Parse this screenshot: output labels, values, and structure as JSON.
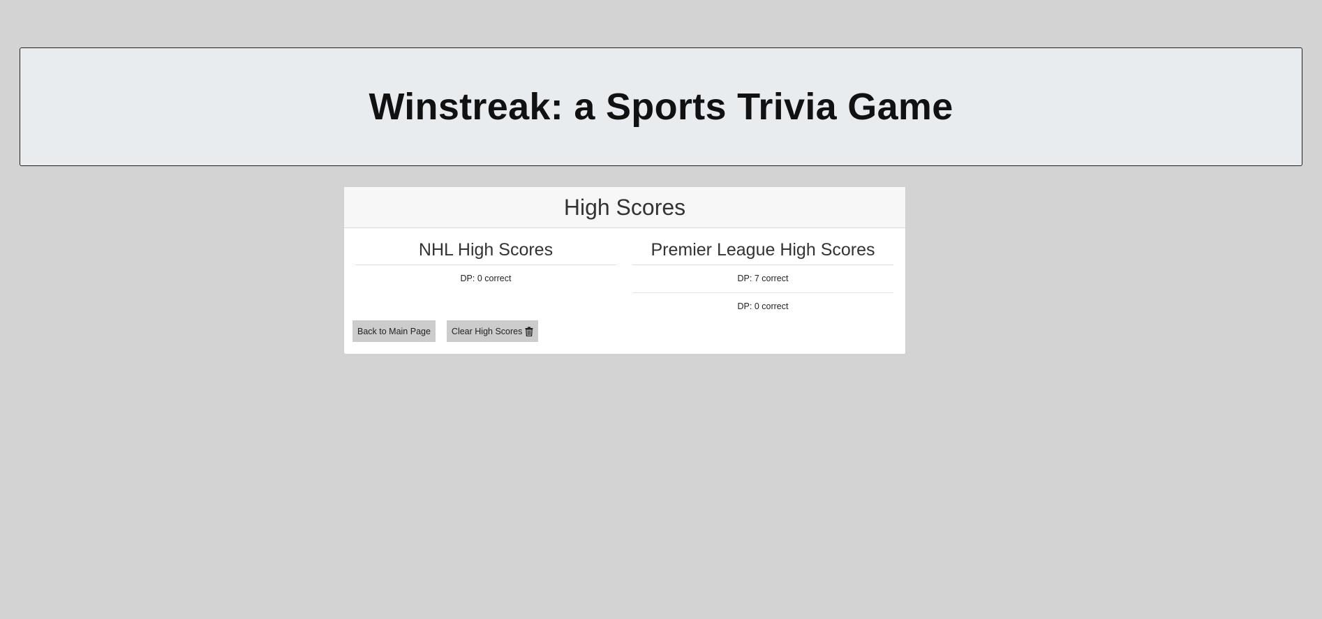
{
  "header": {
    "title": "Winstreak: a Sports Trivia Game"
  },
  "card": {
    "title": "High Scores",
    "columns": [
      {
        "heading": "NHL High Scores",
        "scores": [
          "DP: 0 correct"
        ]
      },
      {
        "heading": "Premier League High Scores",
        "scores": [
          "DP: 7 correct",
          "DP: 0 correct"
        ]
      }
    ],
    "buttons": {
      "back_label": "Back to Main Page",
      "clear_label": "Clear High Scores",
      "clear_icon": "trash-icon"
    }
  }
}
